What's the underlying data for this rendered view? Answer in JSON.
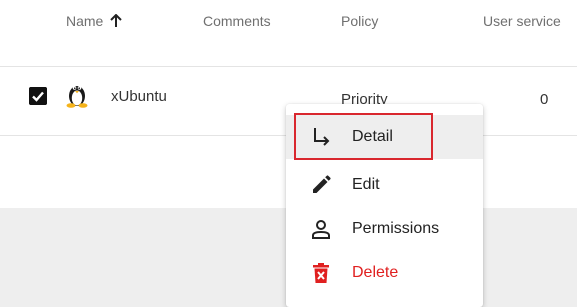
{
  "table": {
    "columns": {
      "name": "Name",
      "comments": "Comments",
      "policy": "Policy",
      "user_service": "User service"
    },
    "sort_icon": "arrow-up-icon",
    "rows": [
      {
        "checked": true,
        "os_icon": "linux-tux-icon",
        "name": "xUbuntu",
        "policy": "Priority",
        "user_service": "0"
      }
    ]
  },
  "context_menu": {
    "items": [
      {
        "label": "Detail",
        "icon": "subdirectory-arrow-icon"
      },
      {
        "label": "Edit",
        "icon": "pencil-icon"
      },
      {
        "label": "Permissions",
        "icon": "person-icon"
      },
      {
        "label": "Delete",
        "icon": "trash-icon"
      }
    ],
    "delete_color": "#e02020",
    "highlight_color": "#d9272e"
  }
}
